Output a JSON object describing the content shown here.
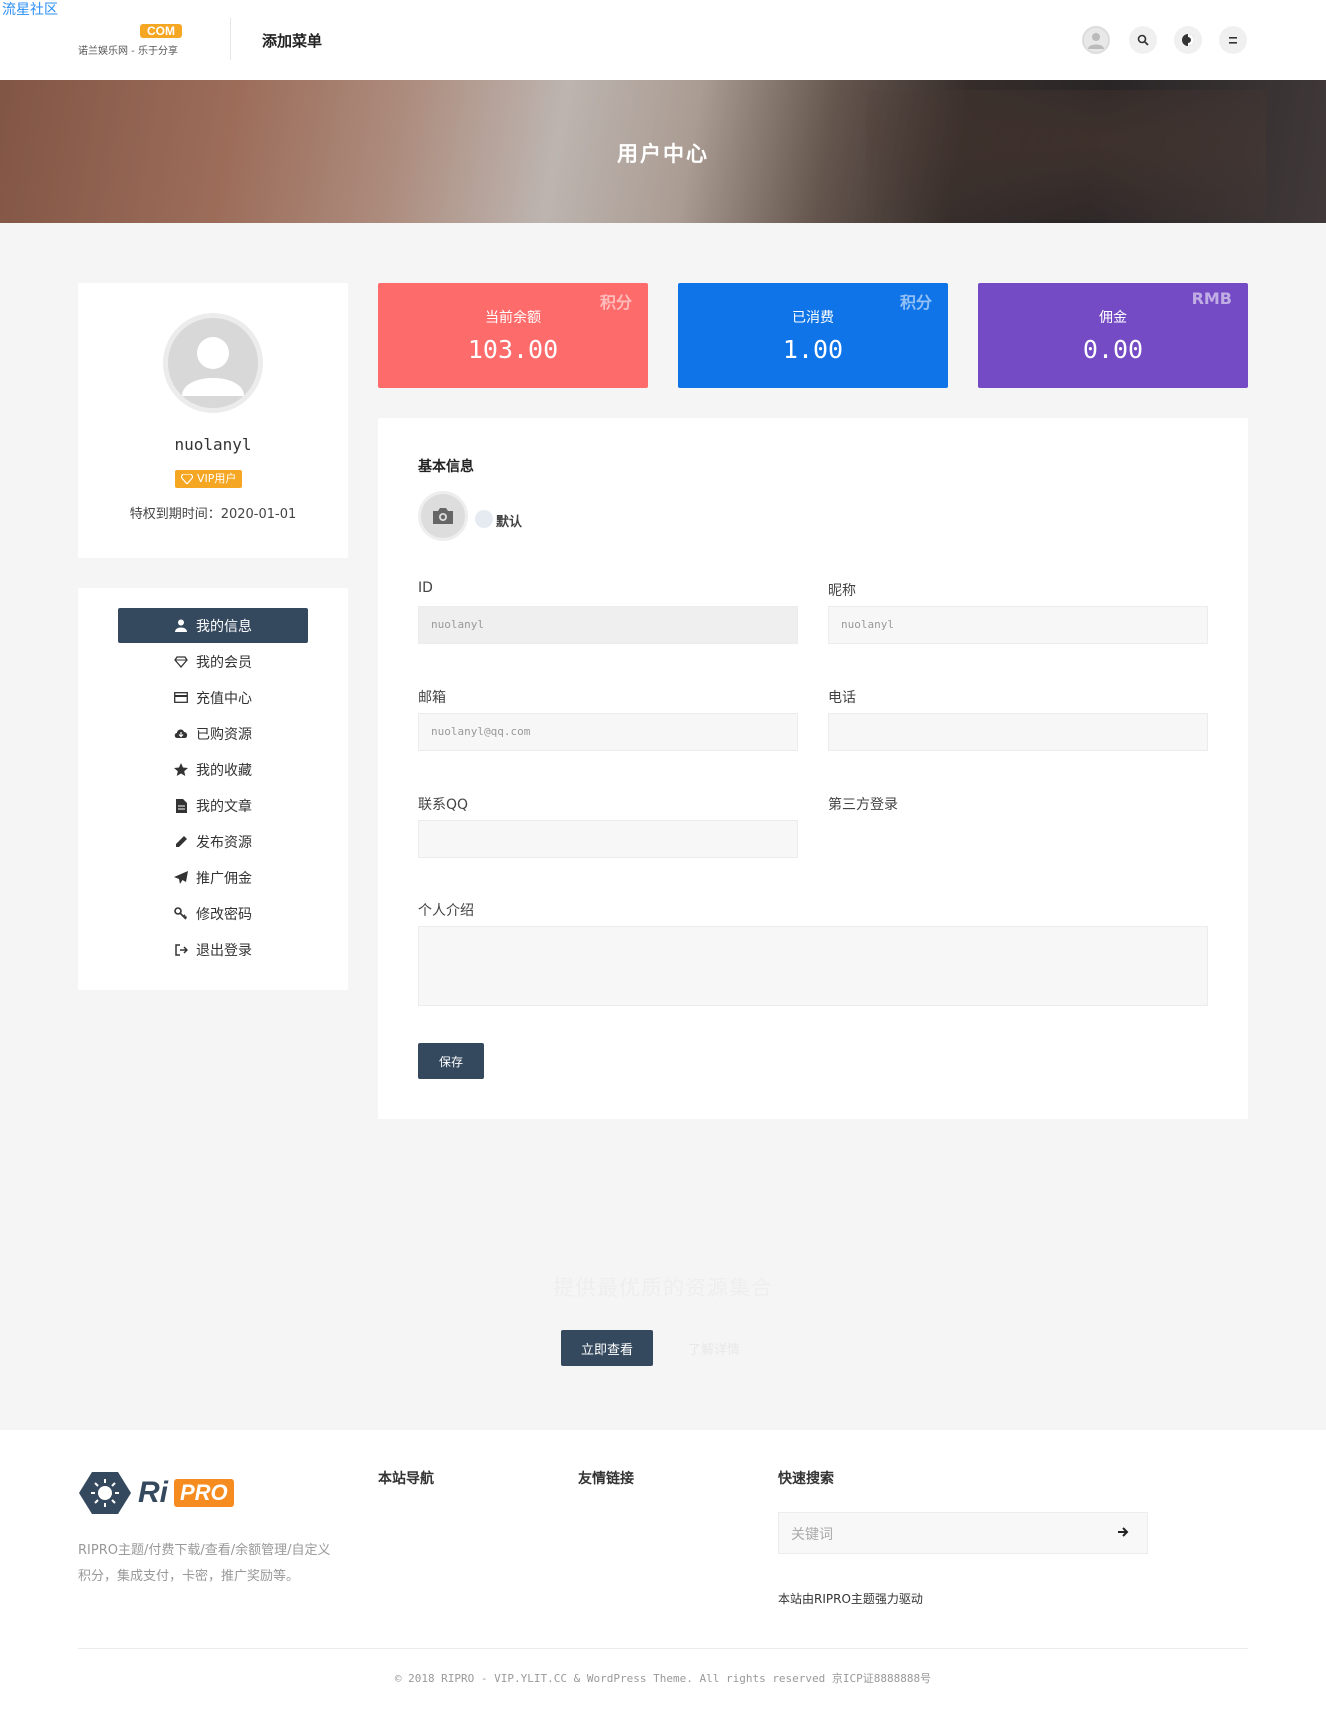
{
  "watermark": "流星社区",
  "header": {
    "logo_com": "COM",
    "logo_sub": "诺兰娱乐网 - 乐于分享",
    "nav_menu": "添加菜单"
  },
  "banner": {
    "title": "用户中心"
  },
  "profile": {
    "username": "nuolanyl",
    "vip_badge": "VIP用户",
    "expire_text": "特权到期时间：2020-01-01"
  },
  "menu": {
    "items": [
      {
        "label": "我的信息"
      },
      {
        "label": "我的会员"
      },
      {
        "label": "充值中心"
      },
      {
        "label": "已购资源"
      },
      {
        "label": "我的收藏"
      },
      {
        "label": "我的文章"
      },
      {
        "label": "发布资源"
      },
      {
        "label": "推广佣金"
      },
      {
        "label": "修改密码"
      },
      {
        "label": "退出登录"
      }
    ]
  },
  "stats": [
    {
      "label": "当前余额",
      "value": "103.00",
      "unit": "积分",
      "color": "#fe6b6b"
    },
    {
      "label": "已消费",
      "value": "1.00",
      "unit": "积分",
      "color": "#0f74e8"
    },
    {
      "label": "佣金",
      "value": "0.00",
      "unit": "RMB",
      "color": "#744bc4"
    }
  ],
  "form": {
    "section_title": "基本信息",
    "avatar_option": "默认",
    "id_label": "ID",
    "id_value": "nuolanyl",
    "nickname_label": "昵称",
    "nickname_value": "nuolanyl",
    "email_label": "邮箱",
    "email_value": "nuolanyl@qq.com",
    "phone_label": "电话",
    "phone_value": "",
    "qq_label": "联系QQ",
    "qq_value": "",
    "third_party_label": "第三方登录",
    "intro_label": "个人介绍",
    "intro_value": "",
    "save_label": "保存"
  },
  "cta": {
    "title": "提供最优质的资源集合",
    "primary": "立即查看",
    "secondary": "了解详情"
  },
  "footer": {
    "logo_ri": "Ri",
    "logo_pro": "PRO",
    "description": "RIPRO主题/付费下载/查看/余额管理/自定义积分，集成支付，卡密，推广奖励等。",
    "nav_heading": "本站导航",
    "links_heading": "友情链接",
    "search_heading": "快速搜索",
    "search_placeholder": "关键词",
    "powered": "本站由RIPRO主题强力驱动",
    "copyright": "© 2018 RIPRO - VIP.YLIT.CC & WordPress Theme. All rights reserved 京ICP证8888888号"
  }
}
